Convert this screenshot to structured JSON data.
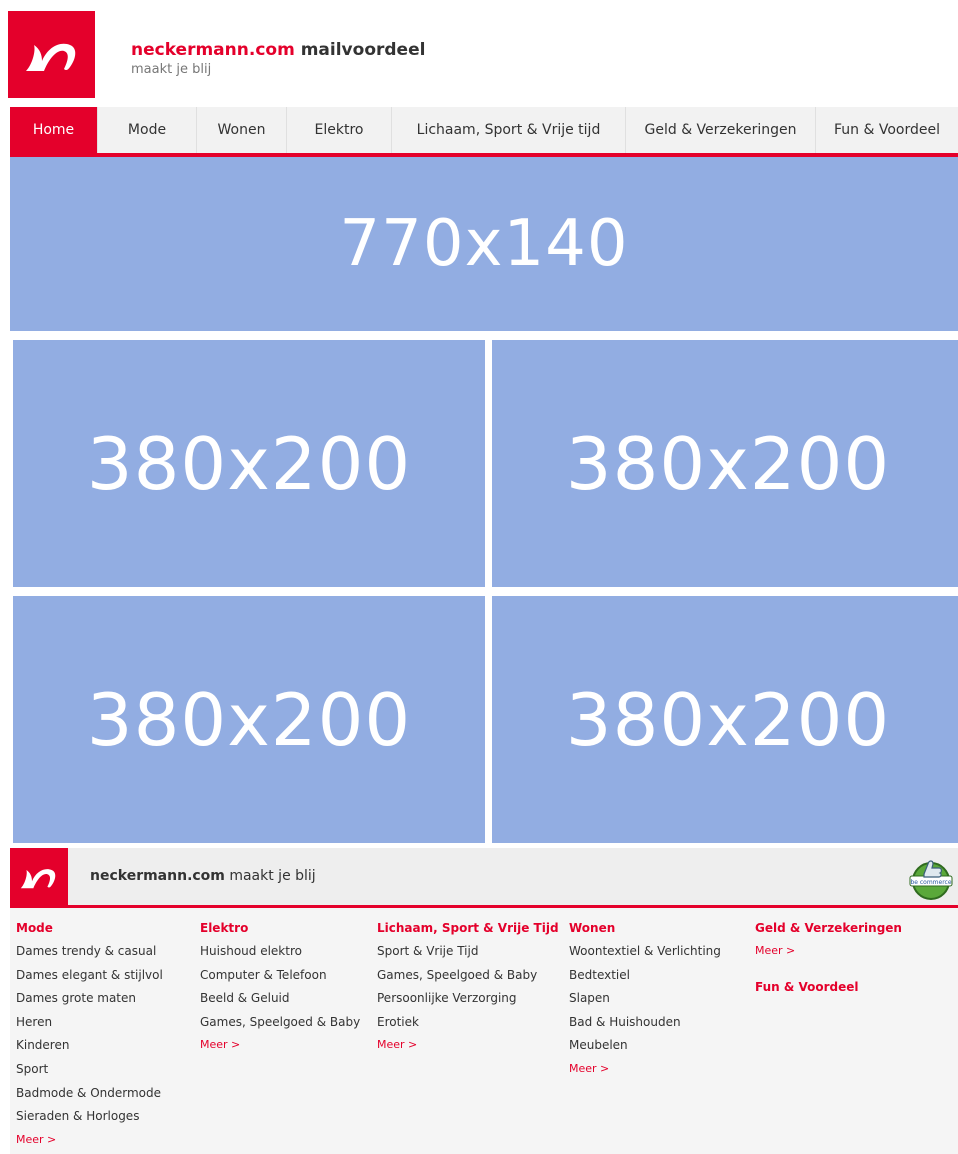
{
  "header": {
    "brand_name": "neckermann.com",
    "brand_suffix": " mailvoordeel",
    "tagline": "maakt je blij"
  },
  "nav": {
    "items": [
      {
        "label": "Home",
        "active": true
      },
      {
        "label": "Mode"
      },
      {
        "label": "Wonen"
      },
      {
        "label": "Elektro"
      },
      {
        "label": "Lichaam, Sport & Vrije tijd"
      },
      {
        "label": "Geld & Verzekeringen"
      },
      {
        "label": "Fun & Voordeel"
      }
    ]
  },
  "banners": {
    "top": "770x140",
    "tile1": "380x200",
    "tile2": "380x200",
    "tile3": "380x200",
    "tile4": "380x200"
  },
  "footer": {
    "brand_name": "neckermann.com",
    "tagline": " maakt je blij",
    "badge_text": "be commerce"
  },
  "columns": [
    {
      "title": "Mode",
      "items": [
        "Dames trendy & casual",
        "Dames elegant & stijlvol",
        "Dames grote maten",
        "Heren",
        "Kinderen",
        "Sport",
        "Badmode & Ondermode",
        "Sieraden & Horloges"
      ],
      "more": "Meer >"
    },
    {
      "title": "Elektro",
      "items": [
        "Huishoud elektro",
        "Computer & Telefoon",
        "Beeld & Geluid",
        "Games, Speelgoed & Baby"
      ],
      "more": "Meer >"
    },
    {
      "title": "Lichaam, Sport & Vrije Tijd",
      "items": [
        "Sport & Vrije Tijd",
        "Games, Speelgoed & Baby",
        "Persoonlijke Verzorging",
        "Erotiek"
      ],
      "more": "Meer >"
    },
    {
      "title": "Wonen",
      "items": [
        "Woontextiel & Verlichting",
        "Bedtextiel",
        "Slapen",
        "Bad & Huishouden",
        "Meubelen"
      ],
      "more": "Meer >"
    },
    {
      "title": "Geld & Verzekeringen",
      "more": "Meer >",
      "title2": "Fun & Voordeel"
    }
  ],
  "colors": {
    "brand_red": "#e4002b",
    "banner_blue": "#92ade2",
    "nav_bg": "#f2f2f2"
  }
}
